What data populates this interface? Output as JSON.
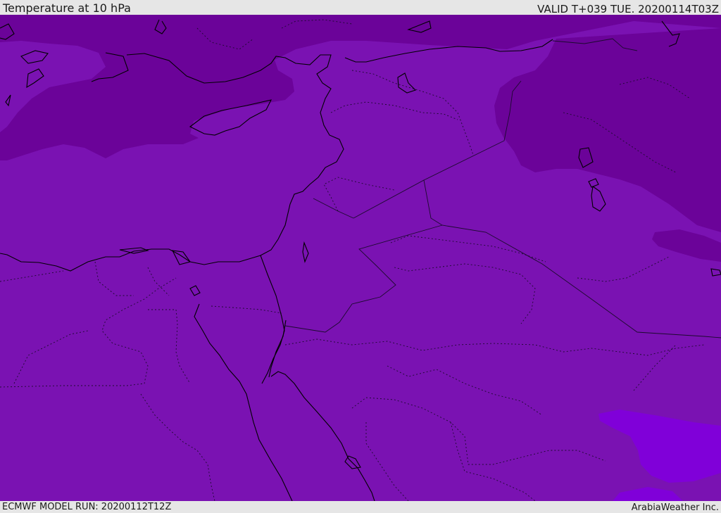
{
  "header": {
    "title": "Temperature at 10 hPa",
    "valid": "VALID T+039 TUE. 20200114T03Z"
  },
  "footer": {
    "model_run": "ECMWF MODEL RUN: 20200112T12Z",
    "credit": "ArabiaWeather Inc."
  },
  "map": {
    "field": "temperature",
    "level": "10 hPa",
    "colors": {
      "base_band": "#7a12b2",
      "cold_band": "#6b0399",
      "warm_band": "#8000d9",
      "coast_line": "#000000",
      "border_line": "#1c0a2e"
    }
  }
}
